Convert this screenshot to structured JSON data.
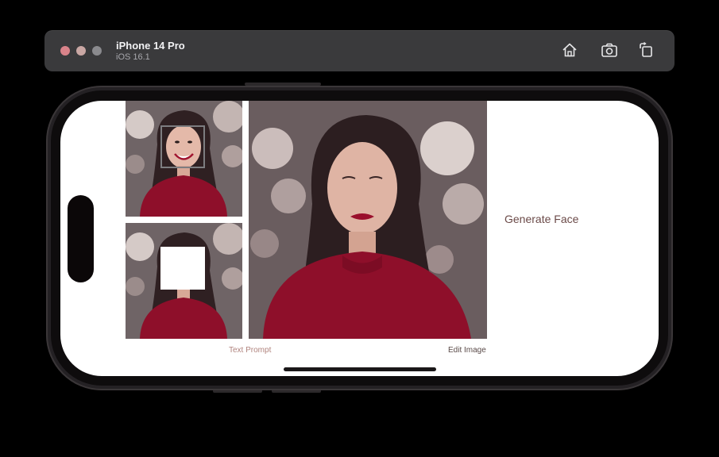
{
  "simulator": {
    "device_name": "iPhone 14 Pro",
    "os_version": "iOS 16.1",
    "toolbar_icons": [
      "home-icon",
      "screenshot-icon",
      "rotate-icon"
    ]
  },
  "app": {
    "generate_label": "Generate Face",
    "tabs": [
      {
        "label": "Text Prompt",
        "selected": false
      },
      {
        "label": "Edit Image",
        "selected": true
      }
    ]
  },
  "colors": {
    "accent_text": "#6b4a48",
    "sweater_red": "#8e0f2a",
    "screen_bg": "#ffffff"
  }
}
